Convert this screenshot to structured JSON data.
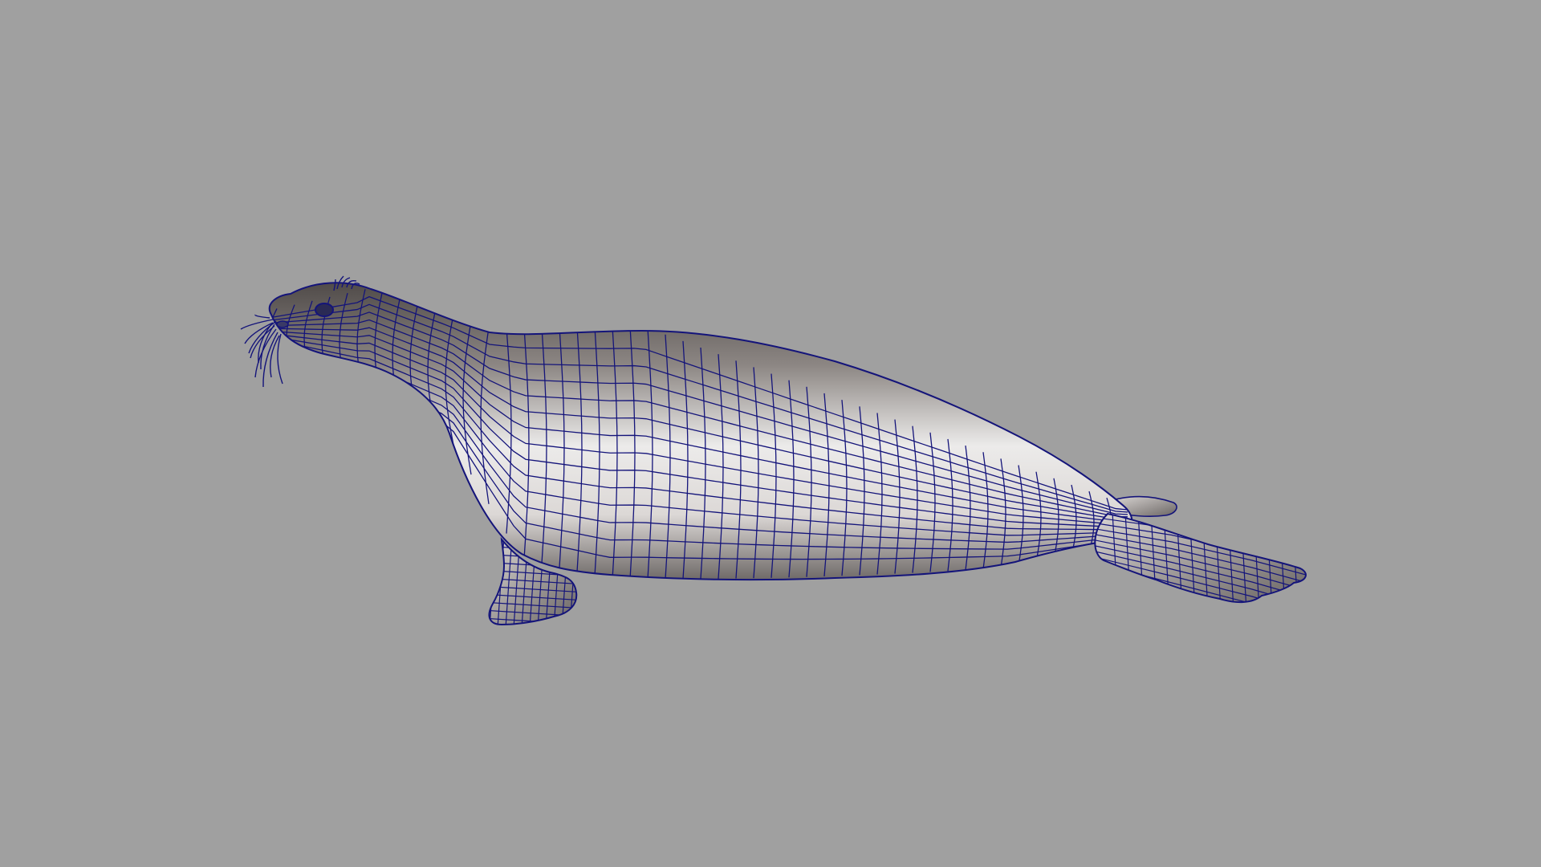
{
  "viewport": {
    "background_color": "#a0a0a0",
    "object": "seal-3d-model",
    "display_mode": "wireframe-on-shaded",
    "wire_color": "#14147a",
    "shade_light": "#f1efee",
    "shade_mid": "#bdb8b5",
    "shade_dark": "#4a4644"
  }
}
